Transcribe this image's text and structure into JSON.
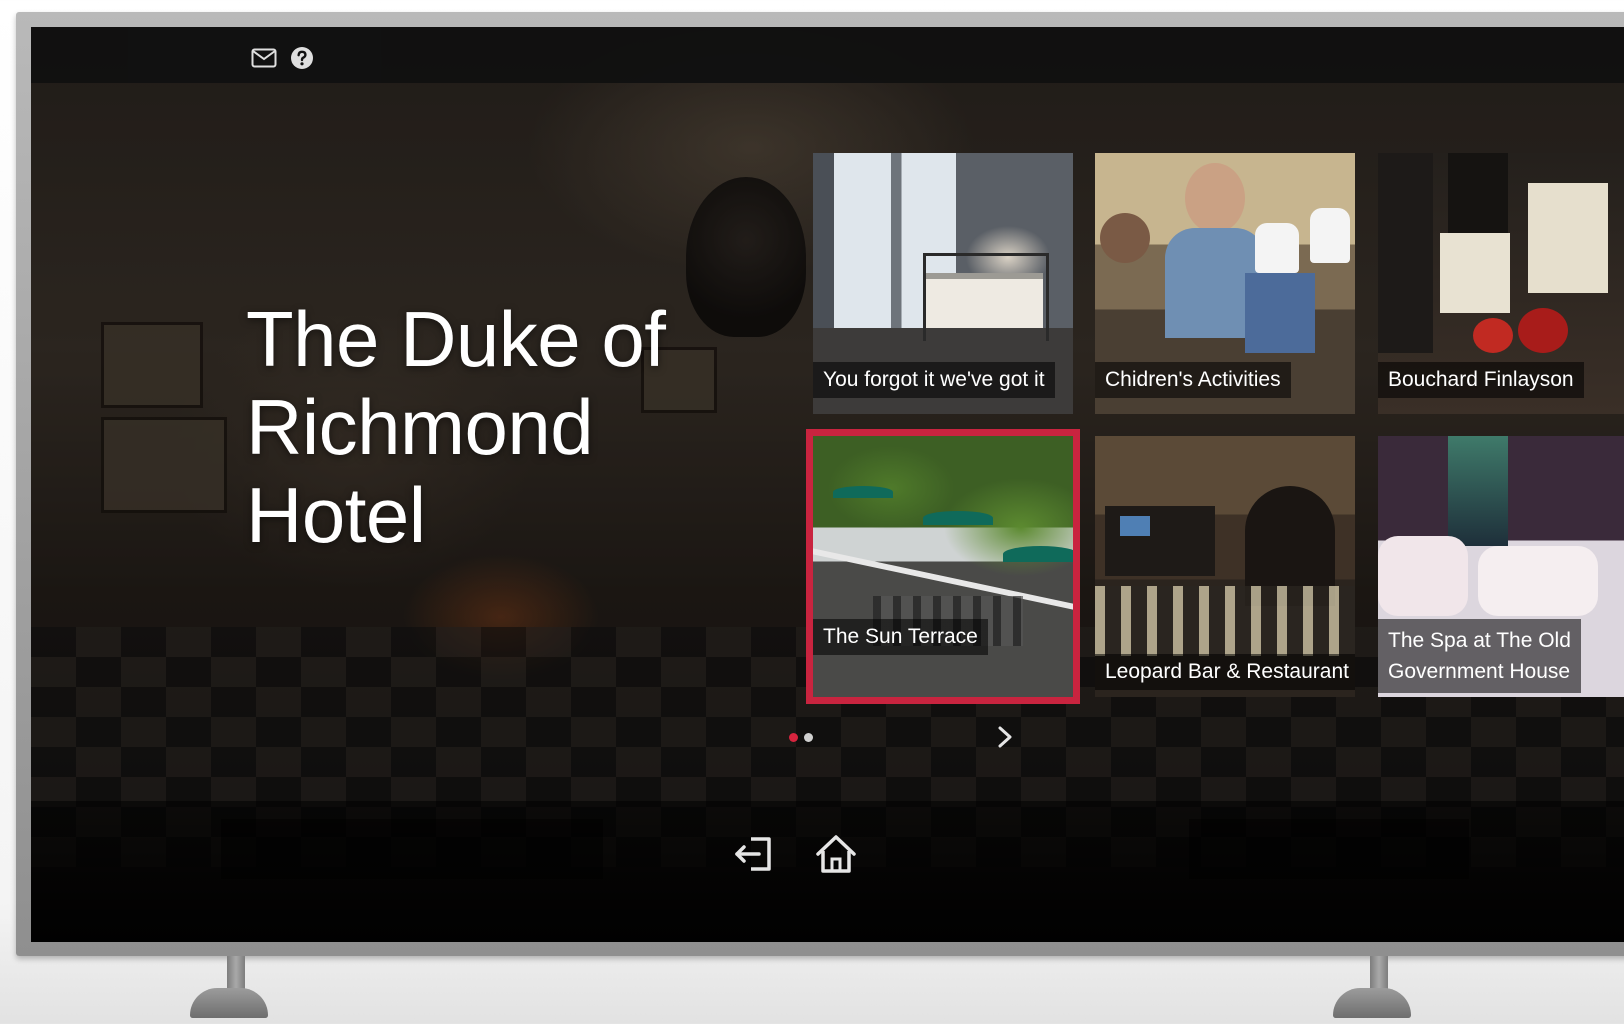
{
  "header": {
    "icons": [
      "mail-icon",
      "help-icon"
    ]
  },
  "hotel": {
    "title_line1": "The Duke of",
    "title_line2": "Richmond",
    "title_line3": "Hotel"
  },
  "tiles": [
    {
      "label": "You forgot it we've got it",
      "selected": false
    },
    {
      "label": "Chidren's Activities",
      "selected": false
    },
    {
      "label": "Bouchard Finlayson",
      "selected": false
    },
    {
      "label": "The Sun Terrace",
      "selected": true
    },
    {
      "label": "Leopard Bar & Restaurant",
      "selected": false
    },
    {
      "label_line1": "The Spa at The Old",
      "label_line2": "Government House",
      "selected": false
    }
  ],
  "pagination": {
    "current": 1,
    "total": 2
  },
  "bottom_nav": {
    "icons": [
      "exit-icon",
      "home-icon"
    ]
  },
  "colors": {
    "accent": "#c9243f",
    "bar": "#111111",
    "text": "#ffffff"
  }
}
